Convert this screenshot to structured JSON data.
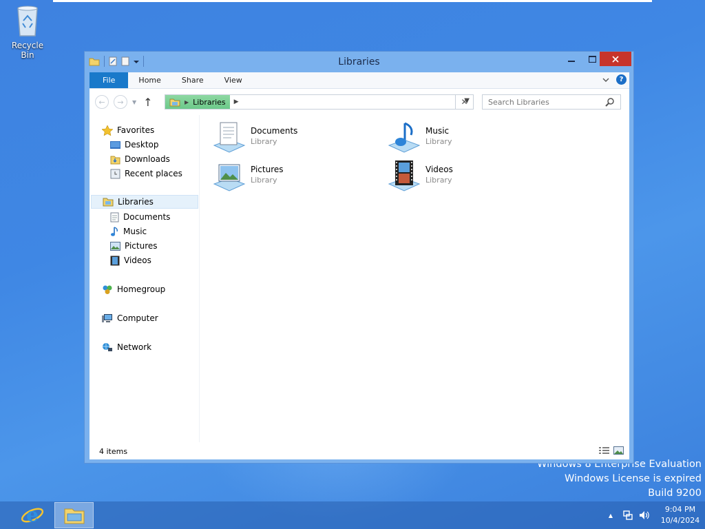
{
  "desktop": {
    "icons": [
      {
        "label": "Recycle Bin",
        "icon": "recycle-bin-icon"
      }
    ],
    "watermark": [
      "Windows 8 Enterprise Evaluation",
      "Windows License is expired",
      "Build 9200"
    ]
  },
  "window": {
    "title": "Libraries",
    "controls": {
      "minimize": "minimize-icon",
      "maximize": "maximize-icon",
      "close": "close-icon"
    },
    "ribbon": {
      "tabs": [
        {
          "label": "File"
        },
        {
          "label": "Home"
        },
        {
          "label": "Share"
        },
        {
          "label": "View"
        }
      ],
      "help": "?"
    },
    "address": {
      "crumbs": [
        "Libraries"
      ],
      "search_placeholder": "Search Libraries"
    },
    "nav": {
      "favorites": {
        "label": "Favorites",
        "items": [
          "Desktop",
          "Downloads",
          "Recent places"
        ]
      },
      "libraries": {
        "label": "Libraries",
        "items": [
          "Documents",
          "Music",
          "Pictures",
          "Videos"
        ]
      },
      "homegroup": "Homegroup",
      "computer": "Computer",
      "network": "Network"
    },
    "libraries": [
      {
        "name": "Documents",
        "type": "Library",
        "icon": "documents-library-icon"
      },
      {
        "name": "Music",
        "type": "Library",
        "icon": "music-library-icon"
      },
      {
        "name": "Pictures",
        "type": "Library",
        "icon": "pictures-library-icon"
      },
      {
        "name": "Videos",
        "type": "Library",
        "icon": "videos-library-icon"
      }
    ],
    "status": {
      "count": "4 items"
    }
  },
  "taskbar": {
    "buttons": [
      {
        "name": "Internet Explorer",
        "icon": "internet-explorer-icon"
      },
      {
        "name": "File Explorer",
        "icon": "file-explorer-icon",
        "active": true
      }
    ],
    "tray": {
      "time": "9:04 PM",
      "date": "10/4/2024"
    }
  },
  "colors": {
    "file_tab": "#1979ca",
    "close_button": "#c7342b",
    "window_frame": "#7ab1ee",
    "selection": "#e5f1fb"
  }
}
